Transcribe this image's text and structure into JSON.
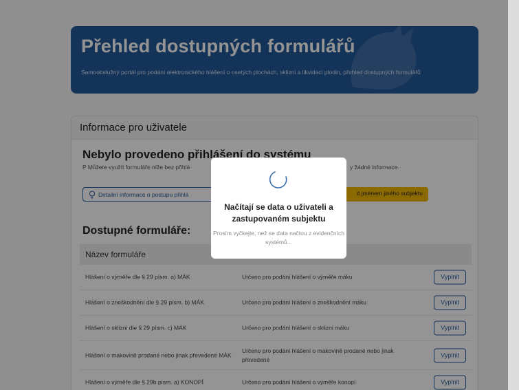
{
  "header": {
    "title": "Přehled dostupných formulářů",
    "subtitle": "Samoobslužný portál pro podání elektronického hlášení o osetých plochách, sklizni a likvidaci plodin, přehled dostupných formulářů"
  },
  "info_card": {
    "heading": "Informace pro uživatele",
    "login_title": "Nebylo provedeno přihlášení do systému",
    "login_text_left": "P Můžete využít formuláře níže bez přihlá",
    "login_text_right": "y žádné informace.",
    "info_button": "Detailní informace o postupu přihlá",
    "yellow_button": "it jménem jiného subjektu"
  },
  "forms": {
    "title": "Dostupné formuláře:",
    "column_header": "Název formuláře",
    "fill_label": "Vyplnit",
    "rows": [
      {
        "name": "Hlášení o výměře dle § 29 písm. a) MÁK",
        "description": "Určeno pro podání hlášení o výměře máku"
      },
      {
        "name": "Hlášení o zneškodnění dle § 29 písm. b) MÁK",
        "description": "Určeno pro podání hlášení o zneškodnění máku"
      },
      {
        "name": "Hlášení o sklizni dle § 29 písm. c) MÁK",
        "description": "Určeno pro podání hlášení o sklizni máku"
      },
      {
        "name": "Hlášení o makovině prodané nebo jinak převedené MÁK",
        "description": "Určeno pro podání hlášení o makovině prodané nebo jinak převedené"
      },
      {
        "name": "Hlášení o výměře dle § 29b písm. a) KONOPÍ",
        "description": "Určeno pro podání hlášení o výměře konopí"
      }
    ]
  },
  "modal": {
    "title": "Načítají se data o uživateli a zastupovaném subjektu",
    "subtitle": "Prosím vyčkejte, než se data načtou z evidenčních systémů..."
  },
  "colors": {
    "brand_blue": "#24599a",
    "warning_yellow": "#f2b705",
    "spinner": "#3d6fb0"
  },
  "icons": {
    "spinner": "loading-spinner-icon",
    "info_button": "lightbulb-icon"
  }
}
